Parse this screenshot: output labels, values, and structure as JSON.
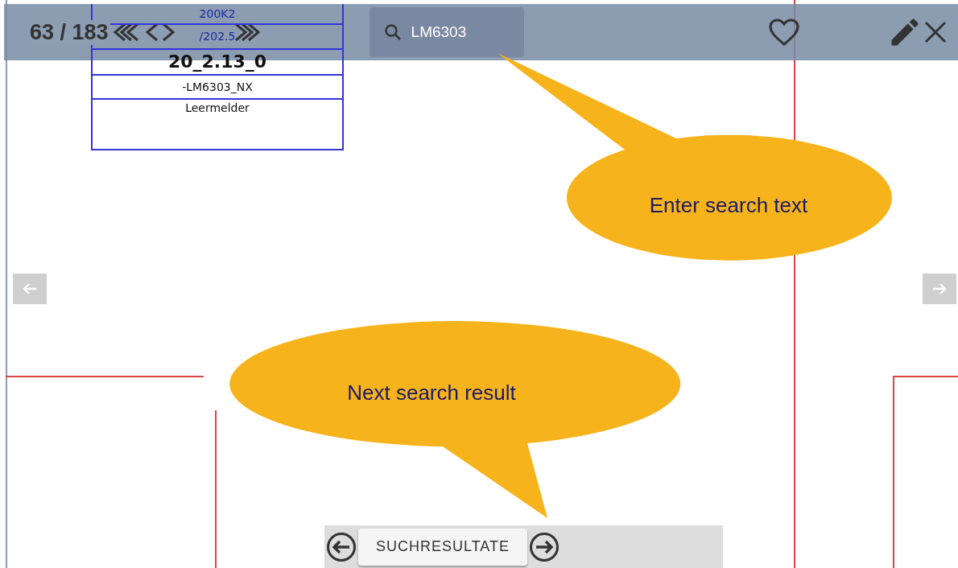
{
  "schematic": {
    "cells": [
      {
        "text": "200K2",
        "kind": "label"
      },
      {
        "text": "/202.5",
        "kind": "label"
      },
      {
        "text": "20_2.13_0",
        "kind": "title"
      },
      {
        "text": "-LM6303_NX",
        "kind": "small"
      },
      {
        "text": "Leermelder",
        "kind": "note"
      }
    ]
  },
  "toolbar": {
    "page_counter": "63 / 183",
    "search": {
      "value": "LM6303"
    },
    "favorite": false
  },
  "callouts": [
    {
      "text": "Enter search text"
    },
    {
      "text": "Next search result"
    }
  ],
  "results_bar": {
    "button": "SUCHRESULTATE"
  }
}
